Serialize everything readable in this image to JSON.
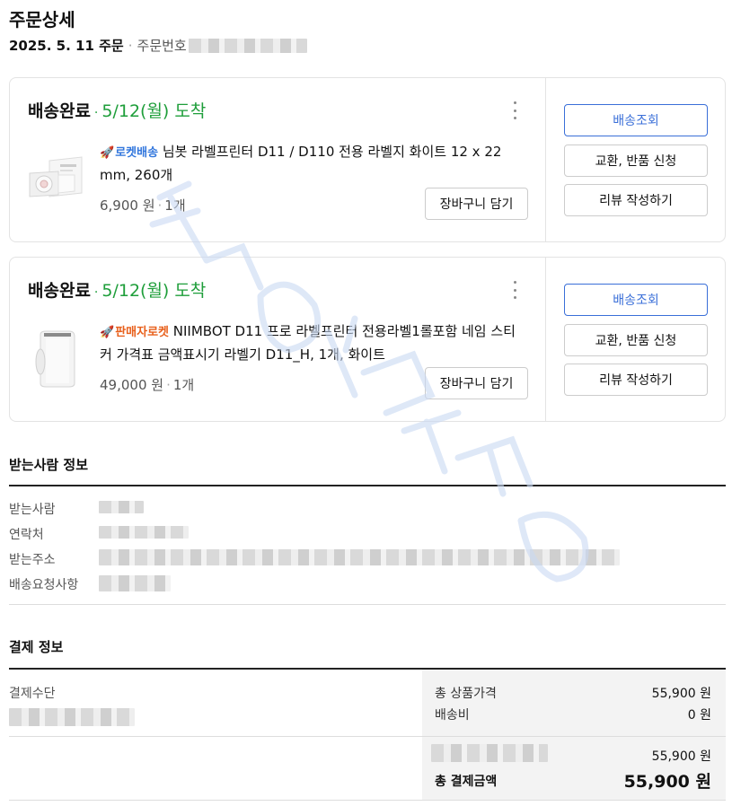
{
  "page": {
    "title": "주문상세"
  },
  "order": {
    "date": "2025. 5. 11 주문",
    "number_label": "주문번호"
  },
  "orders": [
    {
      "status": "배송완료",
      "arrival": "5/12(월) 도착",
      "badge": "로켓배송",
      "product_name": "님봇 라벨프린터 D11 / D110 전용 라벨지 화이트 12 x 22 mm, 260개",
      "price": "6,900 원",
      "quantity": "1개",
      "cart_button": "장바구니 담기",
      "track_button": "배송조회",
      "return_button": "교환, 반품 신청",
      "review_button": "리뷰 작성하기"
    },
    {
      "status": "배송완료",
      "arrival": "5/12(월) 도착",
      "badge": "판매자로켓",
      "product_name": "NIIMBOT D11 프로 라벨프린터 전용라벨1롤포함 네임 스티커 가격표 금액표시기 라벨기 D11_H, 1개, 화이트",
      "price": "49,000 원",
      "quantity": "1개",
      "cart_button": "장바구니 담기",
      "track_button": "배송조회",
      "return_button": "교환, 반품 신청",
      "review_button": "리뷰 작성하기"
    }
  ],
  "recipient": {
    "title": "받는사람 정보",
    "labels": {
      "name": "받는사람",
      "phone": "연락처",
      "address": "받는주소",
      "request": "배송요청사항"
    }
  },
  "payment": {
    "title": "결제 정보",
    "method_label": "결제수단",
    "subtotal_label": "총 상품가격",
    "subtotal_value": "55,900 원",
    "shipping_label": "배송비",
    "shipping_value": "0 원",
    "method_amount": "55,900 원",
    "total_label": "총 결제금액",
    "total_value": "55,900 원"
  },
  "colors": {
    "arrival_green": "#1e9e3a",
    "primary_blue": "#3a6fd8",
    "rocket_blue": "#3377dd",
    "seller_orange": "#e8601c"
  }
}
